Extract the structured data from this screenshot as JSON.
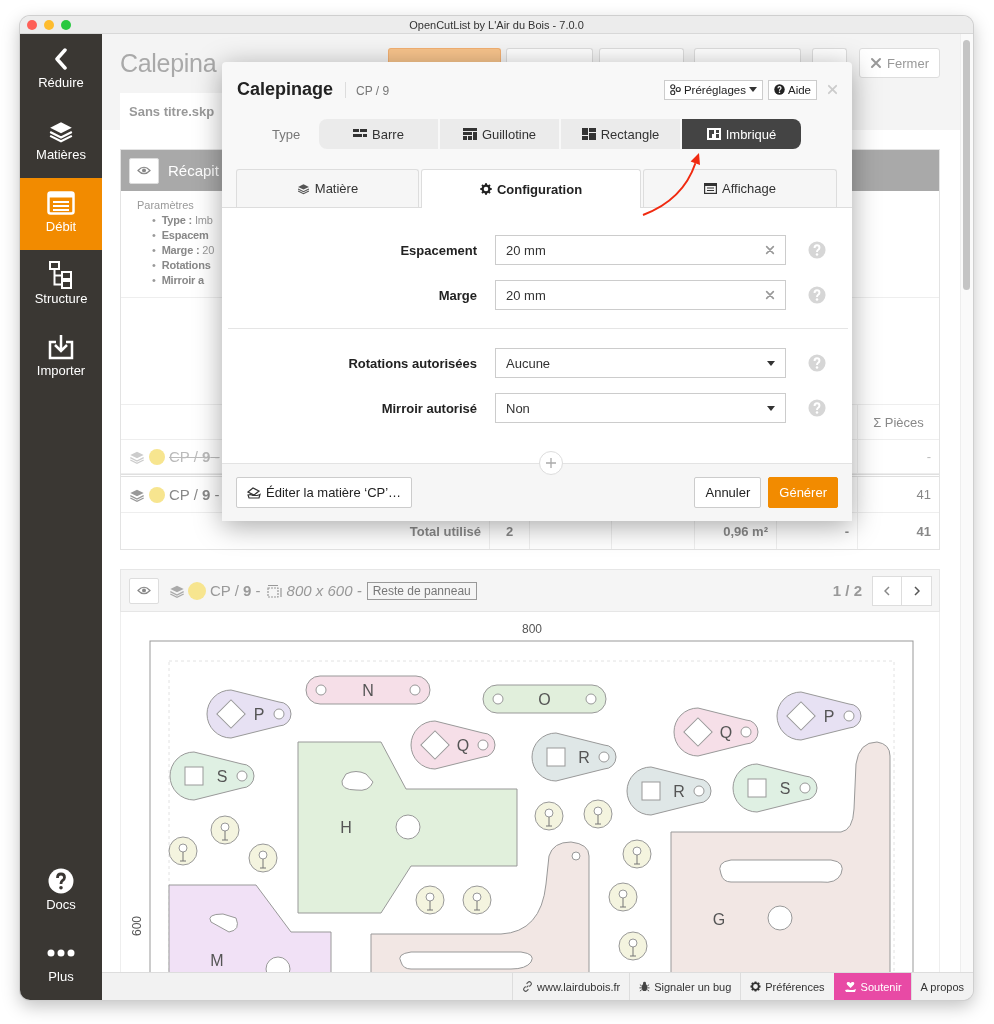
{
  "window": {
    "title": "OpenCutList by L'Air du Bois - 7.0.0"
  },
  "sidebar": {
    "items": [
      {
        "label": "Réduire",
        "selected": false
      },
      {
        "label": "Matières",
        "selected": false
      },
      {
        "label": "Débit",
        "selected": true
      },
      {
        "label": "Structure",
        "selected": false
      },
      {
        "label": "Importer",
        "selected": false
      }
    ],
    "bottom_items": [
      {
        "label": "Docs"
      },
      {
        "label": "Plus"
      }
    ]
  },
  "header": {
    "title": "Calepina",
    "close_button": "Fermer"
  },
  "document_tab": "Sans titre.skp",
  "summary": {
    "title": "Récapit",
    "parameters_label": "Paramètres",
    "parameters": [
      {
        "marker": "•",
        "name": "Type :",
        "value": "Imb"
      },
      {
        "marker": "•",
        "name": "Espacem"
      },
      {
        "marker": "•",
        "name": "Marge :",
        "value": "20"
      },
      {
        "marker": "•",
        "name": "Rotations"
      },
      {
        "marker": "•",
        "name": "Mirroir a"
      }
    ]
  },
  "summary_table": {
    "pieces_heading": "Σ Pièces",
    "rows": [
      {
        "material": "CP / **9** -",
        "color": "#f7e58f",
        "disabled": true,
        "pieces": "-"
      },
      {
        "material": "CP / **9** -",
        "color": "#f7e58f",
        "disabled": false,
        "pieces": "41"
      }
    ],
    "total": {
      "label": "Total utilisé",
      "count": "2",
      "area": "0,96 m²",
      "column_6": "-",
      "pieces": "41"
    }
  },
  "sheet": {
    "material": "CP / **9** -",
    "color": "#f7e58f",
    "size": "800 x 600 -",
    "tag": "Reste de panneau",
    "page": "1 / 2"
  },
  "diagram": {
    "width_label": "800",
    "height_label": "600",
    "parts": [
      {
        "label": "P",
        "color": "#e7e1f3"
      },
      {
        "label": "N",
        "color": "#f6dfe8"
      },
      {
        "label": "O",
        "color": "#e1efdc"
      },
      {
        "label": "Q",
        "color": "#f6dfe8"
      },
      {
        "label": "P",
        "color": "#e7e1f3"
      },
      {
        "label": "Q",
        "color": "#f6dfe8"
      },
      {
        "label": "R",
        "color": "#dfe7e7"
      },
      {
        "label": "S",
        "color": "#dff0e3"
      },
      {
        "label": "H",
        "color": "#e1f0dc"
      },
      {
        "label": "R",
        "color": "#dfe7e7"
      },
      {
        "label": "S",
        "color": "#dff0e3"
      },
      {
        "label": "G",
        "color": "#f2e7e4"
      },
      {
        "label": "M",
        "color": "#f1e1f6"
      }
    ]
  },
  "modal": {
    "title": "Calepinage",
    "subtitle": "CP / 9",
    "presets_button": "Préréglages",
    "help_button": "Aide",
    "type_label": "Type",
    "types": [
      {
        "label": "Barre",
        "selected": false
      },
      {
        "label": "Guillotine",
        "selected": false
      },
      {
        "label": "Rectangle",
        "selected": false
      },
      {
        "label": "Imbriqué",
        "selected": true
      }
    ],
    "tabs": [
      {
        "label": "Matière",
        "selected": false
      },
      {
        "label": "Configuration",
        "selected": true
      },
      {
        "label": "Affichage",
        "selected": false
      }
    ],
    "fields": [
      {
        "kind": "text",
        "label": "Espacement",
        "value": "20 mm"
      },
      {
        "kind": "text",
        "label": "Marge",
        "value": "20 mm"
      },
      {
        "kind": "select",
        "label": "Rotations autorisées",
        "value": "Aucune"
      },
      {
        "kind": "select",
        "label": "Mirroir autorisé",
        "value": "Non"
      }
    ],
    "edit_material_button": "Éditer la matière ‘CP’…",
    "cancel_button": "Annuler",
    "generate_button": "Générer"
  },
  "footer": {
    "links": [
      {
        "label": "www.lairdubois.fr",
        "highlighted": false
      },
      {
        "label": "Signaler un bug",
        "highlighted": false
      },
      {
        "label": "Préférences",
        "highlighted": false
      },
      {
        "label": "Soutenir",
        "highlighted": true
      },
      {
        "label": "A propos",
        "highlighted": false
      }
    ]
  }
}
